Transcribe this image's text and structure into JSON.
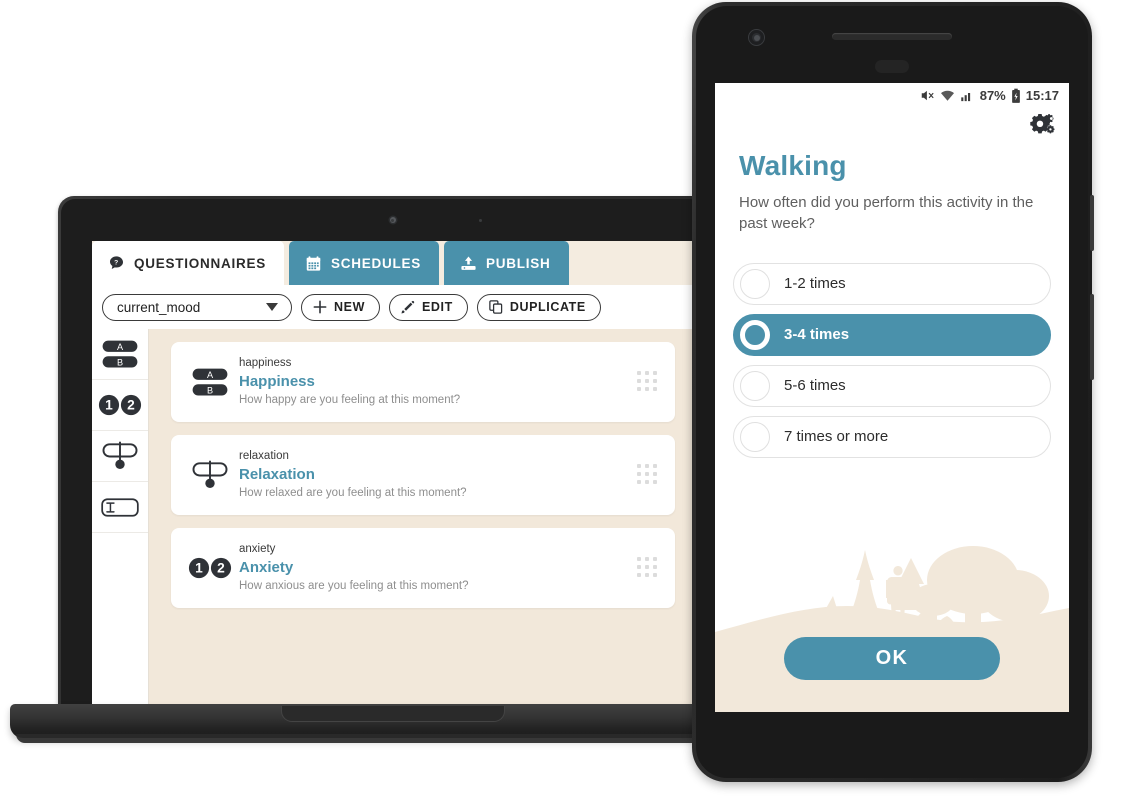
{
  "desktop": {
    "tabs": [
      {
        "label": "QUESTIONNAIRES",
        "icon": "question-bubble-icon",
        "active": true
      },
      {
        "label": "SCHEDULES",
        "icon": "calendar-icon",
        "active": false
      },
      {
        "label": "PUBLISH",
        "icon": "upload-icon",
        "active": false
      }
    ],
    "toolbar": {
      "questionnaire_select_value": "current_mood",
      "new_label": "NEW",
      "edit_label": "EDIT",
      "duplicate_label": "DUPLICATE"
    },
    "tool_rail": [
      {
        "name": "multiple-choice-ab-tool",
        "icon": "ab-choice-icon"
      },
      {
        "name": "numeric-choice-tool",
        "icon": "one-two-circles-icon"
      },
      {
        "name": "slider-tool",
        "icon": "slider-icon"
      },
      {
        "name": "text-input-tool",
        "icon": "text-field-icon"
      }
    ],
    "questions": [
      {
        "key": "happiness",
        "title": "Happiness",
        "prompt": "How happy are you feeling at this moment?",
        "icon": "ab-choice-icon"
      },
      {
        "key": "relaxation",
        "title": "Relaxation",
        "prompt": "How relaxed are you feeling at this moment?",
        "icon": "slider-icon"
      },
      {
        "key": "anxiety",
        "title": "Anxiety",
        "prompt": "How anxious are you feeling at this moment?",
        "icon": "one-two-circles-icon"
      }
    ]
  },
  "phone": {
    "statusbar": {
      "battery_percent": "87%",
      "time": "15:17",
      "icons": [
        "mute-icon",
        "wifi-icon",
        "signal-icon",
        "battery-icon"
      ]
    },
    "settings_icon": "gears-icon",
    "title": "Walking",
    "question": "How often did you perform this activity in the past week?",
    "options": [
      {
        "label": "1-2 times",
        "selected": false
      },
      {
        "label": "3-4 times",
        "selected": true
      },
      {
        "label": "5-6 times",
        "selected": false
      },
      {
        "label": "7 times or more",
        "selected": false
      }
    ],
    "ok_label": "OK"
  },
  "colors": {
    "accent_teal": "#4a91ab",
    "canvas_beige": "#f2e8da",
    "dark_ink": "#2f3237",
    "muted_text": "#8e8e8e"
  }
}
